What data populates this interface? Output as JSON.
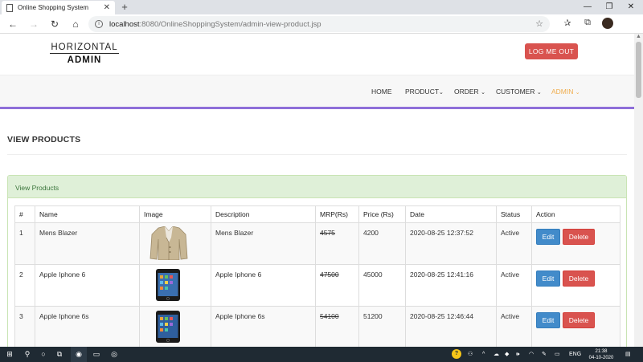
{
  "browser": {
    "tab_title": "Online Shopping System",
    "url_host": "localhost",
    "url_rest": ":8080/OnlineShoppingSystem/admin-view-product.jsp"
  },
  "header": {
    "brand_top": "HORIZONTAL",
    "brand_bottom": "ADMIN",
    "logout_label": "LOG ME OUT"
  },
  "nav": {
    "items": [
      {
        "label": "HOME"
      },
      {
        "label": "PRODUCT"
      },
      {
        "label": "ORDER"
      },
      {
        "label": "CUSTOMER"
      },
      {
        "label": "ADMIN"
      }
    ]
  },
  "page": {
    "title": "VIEW PRODUCTS",
    "panel_heading": "View Products"
  },
  "table": {
    "columns": [
      "#",
      "Name",
      "Image",
      "Description",
      "MRP(Rs)",
      "Price (Rs)",
      "Date",
      "Status",
      "Action"
    ],
    "rows": [
      {
        "num": "1",
        "name": "Mens Blazer",
        "image": "blazer",
        "description": "Mens Blazer",
        "mrp": "4575",
        "price": "4200",
        "date": "2020-08-25 12:37:52",
        "status": "Active"
      },
      {
        "num": "2",
        "name": "Apple Iphone 6",
        "image": "phone",
        "description": "Apple Iphone 6",
        "mrp": "47500",
        "price": "45000",
        "date": "2020-08-25 12:41:16",
        "status": "Active"
      },
      {
        "num": "3",
        "name": "Apple Iphone 6s",
        "image": "phone",
        "description": "Apple Iphone 6s",
        "mrp": "54100",
        "price": "51200",
        "date": "2020-08-25 12:46:44",
        "status": "Active"
      }
    ],
    "edit_label": "Edit",
    "delete_label": "Delete"
  },
  "taskbar": {
    "language": "ENG",
    "time": "21:38",
    "date": "04-10-2020"
  },
  "colors": {
    "accent_line": "#8e6fd9",
    "active_nav": "#f0ad4e",
    "danger": "#d9534f",
    "primary": "#428bca",
    "panel_bg": "#dff0d8"
  }
}
